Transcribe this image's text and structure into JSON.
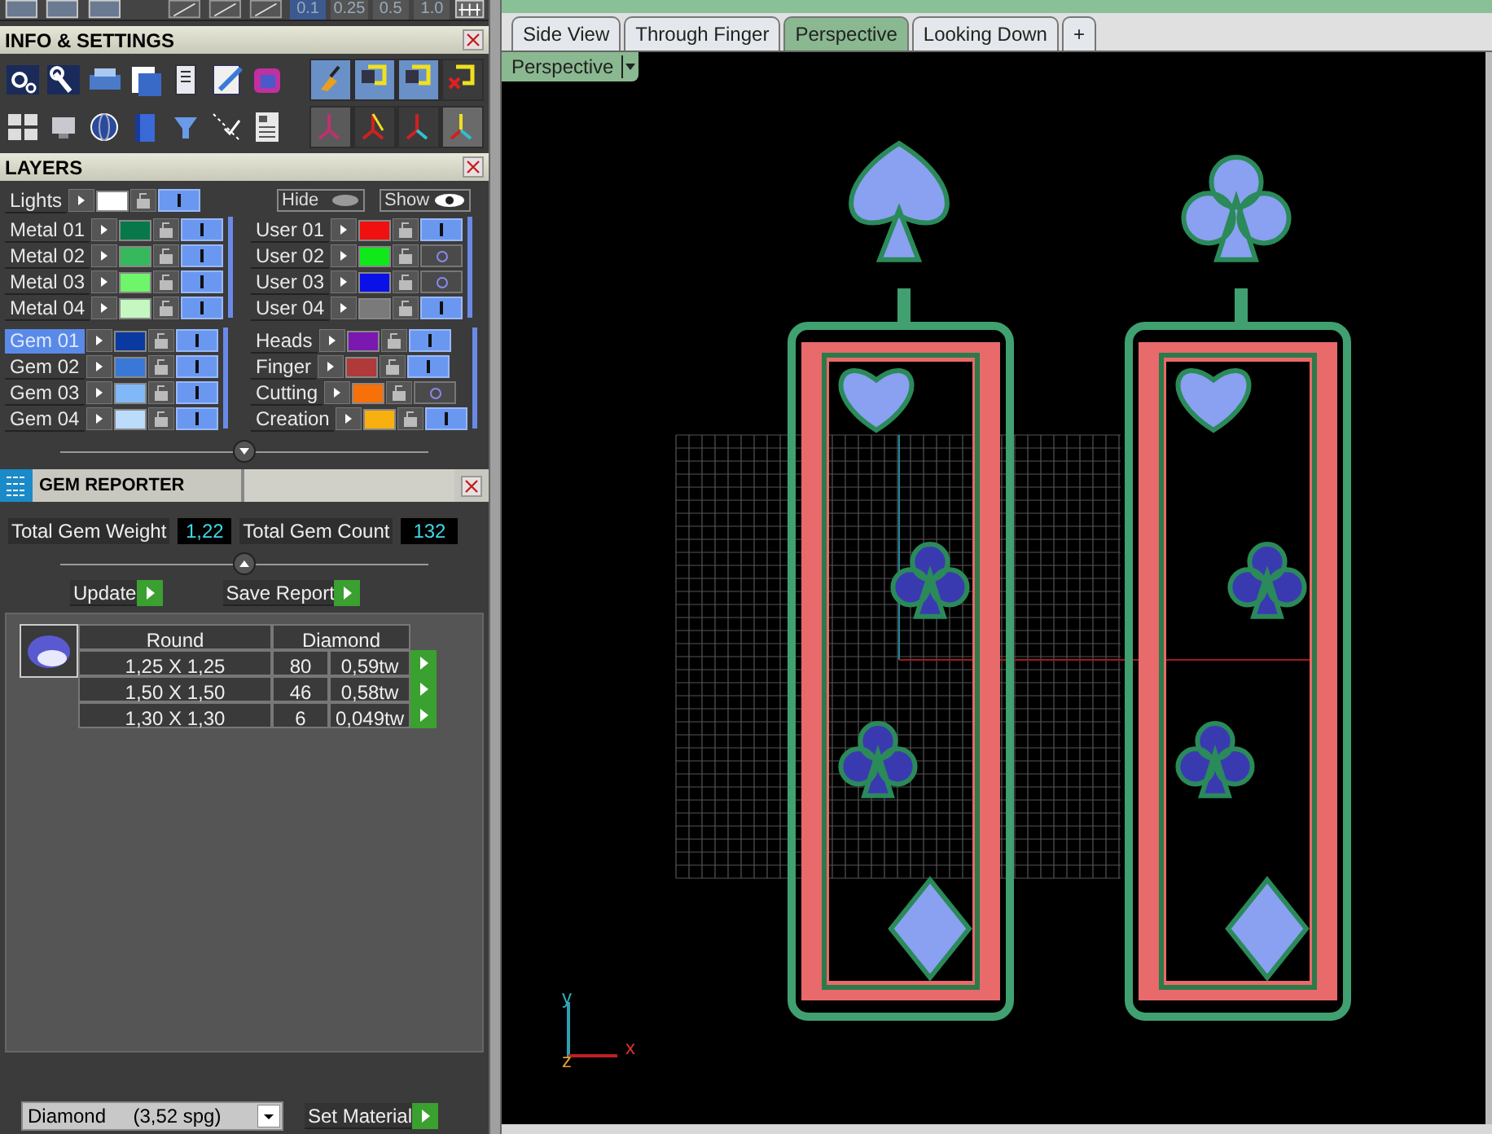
{
  "toolbar": {
    "snap_steps": [
      {
        "label": "0.1",
        "selected": true
      },
      {
        "label": "0.25",
        "selected": false
      },
      {
        "label": "0.5",
        "selected": false
      },
      {
        "label": "1.0",
        "selected": false
      }
    ]
  },
  "info_settings": {
    "title": "INFO & SETTINGS"
  },
  "layers": {
    "title": "LAYERS",
    "lights": {
      "name": "Lights",
      "color": "#ffffff",
      "visible": true
    },
    "hide_button": "Hide",
    "show_button": "Show",
    "groups": [
      {
        "rows": [
          {
            "name": "Metal 01",
            "color": "#08784a",
            "visible": true,
            "selected": false
          },
          {
            "name": "Metal 02",
            "color": "#36b85c",
            "visible": true,
            "selected": false
          },
          {
            "name": "Metal 03",
            "color": "#6ef56a",
            "visible": true,
            "selected": false
          },
          {
            "name": "Metal 04",
            "color": "#c4f8c0",
            "visible": true,
            "selected": false
          }
        ]
      },
      {
        "rows": [
          {
            "name": "User 01",
            "color": "#f01010",
            "visible": true,
            "selected": false
          },
          {
            "name": "User 02",
            "color": "#10e81a",
            "visible": false,
            "selected": false
          },
          {
            "name": "User 03",
            "color": "#0a10e8",
            "visible": false,
            "selected": false
          },
          {
            "name": "User 04",
            "color": "#7a7a7a",
            "visible": true,
            "selected": false
          }
        ]
      },
      {
        "rows": [
          {
            "name": "Gem 01",
            "color": "#0a3aa0",
            "visible": true,
            "selected": true
          },
          {
            "name": "Gem 02",
            "color": "#3a78d8",
            "visible": true,
            "selected": false
          },
          {
            "name": "Gem 03",
            "color": "#80b8f8",
            "visible": true,
            "selected": false
          },
          {
            "name": "Gem 04",
            "color": "#bcdcfc",
            "visible": true,
            "selected": false
          }
        ]
      },
      {
        "rows": [
          {
            "name": "Heads",
            "color": "#7a18b0",
            "visible": true,
            "selected": false
          },
          {
            "name": "Finger",
            "color": "#b03a3a",
            "visible": true,
            "selected": false
          },
          {
            "name": "Cutting",
            "color": "#f87008",
            "visible": false,
            "selected": false
          },
          {
            "name": "Creation",
            "color": "#f8b010",
            "visible": true,
            "selected": false
          }
        ]
      }
    ]
  },
  "gem_reporter": {
    "title": "GEM REPORTER",
    "total_weight_label": "Total Gem Weight",
    "total_weight": "1,22",
    "total_count_label": "Total Gem Count",
    "total_count": "132",
    "update_button": "Update",
    "save_button": "Save Report",
    "table": {
      "columns": [
        "Round",
        "Diamond"
      ],
      "rows": [
        {
          "size": "1,25 X 1,25",
          "count": "80",
          "weight": "0,59tw"
        },
        {
          "size": "1,50 X 1,50",
          "count": "46",
          "weight": "0,58tw"
        },
        {
          "size": "1,30 X 1,30",
          "count": "6",
          "weight": "0,049tw"
        }
      ]
    },
    "material": "Diamond     (3,52 spg)",
    "set_material_button": "Set Material"
  },
  "viewport": {
    "tabs": [
      {
        "label": "Side View",
        "selected": false
      },
      {
        "label": "Through Finger",
        "selected": false
      },
      {
        "label": "Perspective",
        "selected": true
      },
      {
        "label": "Looking Down",
        "selected": false
      },
      {
        "label": "+",
        "selected": false
      }
    ],
    "view_mode": "Perspective",
    "axes": [
      "x",
      "y",
      "z"
    ]
  }
}
